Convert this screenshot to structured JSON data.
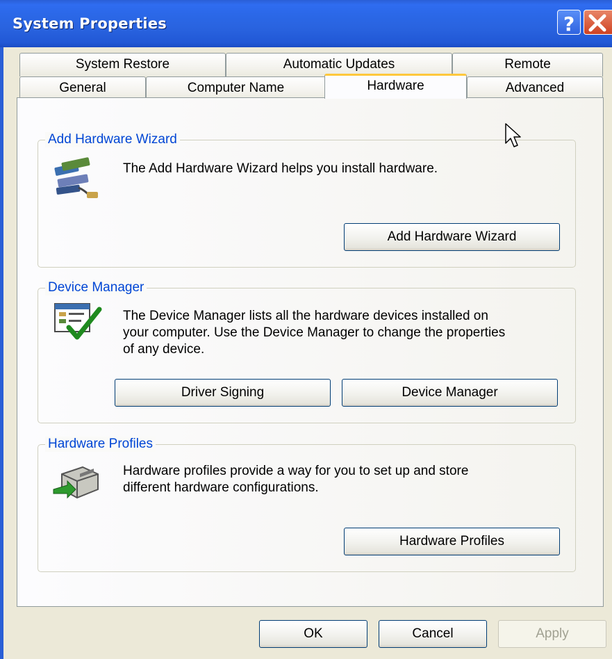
{
  "window": {
    "title": "System Properties"
  },
  "titlebar": {
    "help_icon": "help-icon",
    "close_icon": "close-icon"
  },
  "tabs": {
    "back_row": [
      "System Restore",
      "Automatic Updates",
      "Remote"
    ],
    "front_row": [
      "General",
      "Computer Name",
      "Hardware",
      "Advanced"
    ],
    "active": "Hardware"
  },
  "sections": {
    "add_hardware": {
      "title": "Add Hardware Wizard",
      "description": "The Add Hardware Wizard helps you install hardware.",
      "button": "Add Hardware Wizard",
      "icon": "hardware-wizard-icon"
    },
    "device_manager": {
      "title": "Device Manager",
      "description_lines": [
        "The Device Manager lists all the hardware devices installed on",
        "your computer. Use the Device Manager to change the properties",
        "of any device."
      ],
      "buttons": [
        "Driver Signing",
        "Device Manager"
      ],
      "icon": "device-manager-icon"
    },
    "hardware_profiles": {
      "title": "Hardware Profiles",
      "description_lines": [
        "Hardware profiles provide a way for you to set up and store",
        "different hardware configurations."
      ],
      "button": "Hardware Profiles",
      "icon": "hardware-profiles-icon"
    }
  },
  "footer": {
    "ok": "OK",
    "cancel": "Cancel",
    "apply": "Apply"
  },
  "colors": {
    "title_bar": "#2b68e8",
    "group_title": "#0046d5",
    "active_tab_accent": "#ffc83c",
    "dialog_bg": "#ECE9D8"
  }
}
